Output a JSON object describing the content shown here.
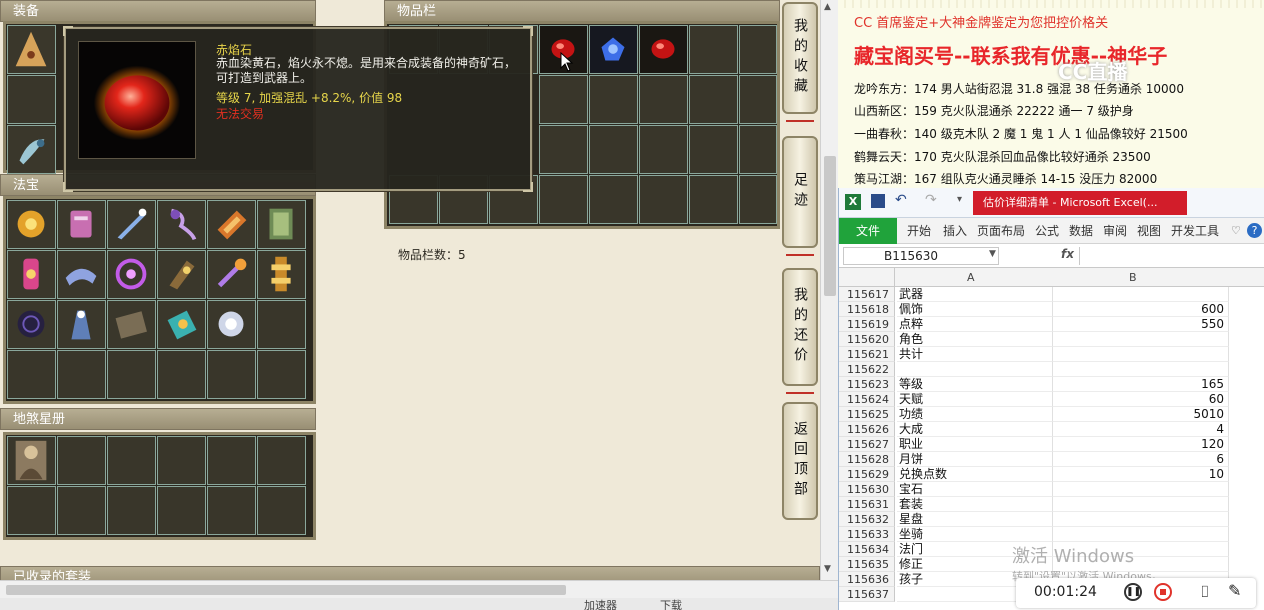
{
  "game": {
    "equipment_header": "装备",
    "inventory_header": "物品栏",
    "treasure_header": "法宝",
    "star_header": "地煞星册",
    "collected_header": "已收录的套装",
    "item_count_label": "物品栏数：5",
    "tooltip": {
      "name": "赤焰石",
      "description": "赤血染黄石，焰火永不熄。是用来合成装备的神奇矿石，可打造到武器上。",
      "stats": "等级 7, 加强混乱 +8.2%, 价值 98",
      "trade": "无法交易"
    },
    "side_buttons": [
      {
        "label": "我的收藏"
      },
      {
        "label": "足迹"
      },
      {
        "label": "我的还价"
      },
      {
        "label": "返回顶部"
      }
    ],
    "status_bar": {
      "left_text": "加速器",
      "right_text": "下载"
    }
  },
  "promo": {
    "line_appraisal": "CC 首席鉴定+大神金牌鉴定为您把控价格关",
    "headline": "藏宝阁买号--联系我有优惠--神华子",
    "logo_text": "CC直播",
    "listings": [
      "龙吟东方：174 男人站街忍混 31.8 强混 38 任务通杀 10000",
      "山西新区：159 克火队混通杀 22222 通一 7 级护身",
      "一曲春秋：140 级克木队 2 魔 1 鬼 1 人 1 仙品像较好 21500",
      "鹤舞云天：170 克火队混杀回血品像比较好通杀 23500",
      "策马江湖：167 组队克火通灵睡杀 14-15 没压力 82000"
    ]
  },
  "excel": {
    "window_title": "估价详细清单 - Microsoft Excel(...",
    "file_tab": "文件",
    "tabs": [
      "开始",
      "插入",
      "页面布局",
      "公式",
      "数据",
      "审阅",
      "视图",
      "开发工具"
    ],
    "name_box": "B115630",
    "fx": "fx",
    "columns": [
      "A",
      "B"
    ],
    "rows": [
      {
        "n": "115617",
        "a": "武器",
        "b": ""
      },
      {
        "n": "115618",
        "a": "佩饰",
        "b": "600"
      },
      {
        "n": "115619",
        "a": "点粹",
        "b": "550"
      },
      {
        "n": "115620",
        "a": "角色",
        "b": ""
      },
      {
        "n": "115621",
        "a": "共计",
        "b": ""
      },
      {
        "n": "115622",
        "a": "",
        "b": ""
      },
      {
        "n": "115623",
        "a": "等级",
        "b": "165"
      },
      {
        "n": "115624",
        "a": "天赋",
        "b": "60"
      },
      {
        "n": "115625",
        "a": "功绩",
        "b": "5010"
      },
      {
        "n": "115626",
        "a": "大成",
        "b": "4"
      },
      {
        "n": "115627",
        "a": "职业",
        "b": "120"
      },
      {
        "n": "115628",
        "a": "月饼",
        "b": "6"
      },
      {
        "n": "115629",
        "a": "兑换点数",
        "b": "10"
      },
      {
        "n": "115630",
        "a": "宝石",
        "b": ""
      },
      {
        "n": "115631",
        "a": "套装",
        "b": ""
      },
      {
        "n": "115632",
        "a": "星盘",
        "b": ""
      },
      {
        "n": "115633",
        "a": "坐骑",
        "b": ""
      },
      {
        "n": "115634",
        "a": "法门",
        "b": ""
      },
      {
        "n": "115635",
        "a": "修正",
        "b": ""
      },
      {
        "n": "115636",
        "a": "孩子",
        "b": ""
      },
      {
        "n": "115637",
        "a": "",
        "b": ""
      }
    ]
  },
  "overlay": {
    "watermark": "激活 Windows",
    "watermark_sub": "转到\"设置\"以激活 Windows。",
    "recorder_time": "00:01:24"
  },
  "colors": {
    "headline_red": "#e8262a",
    "promo_red": "#e0332b",
    "excel_green": "#20a33b",
    "title_red": "#d21d2a"
  }
}
